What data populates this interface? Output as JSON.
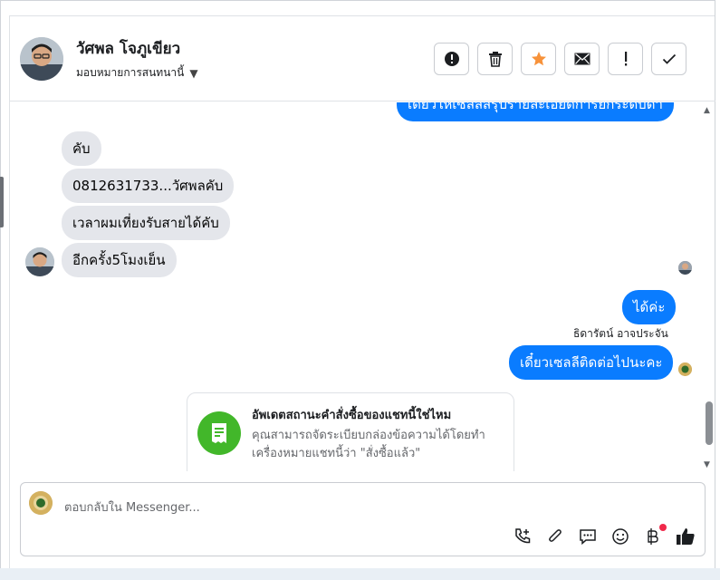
{
  "header": {
    "contact_name": "วัศพล โจภูเขียว",
    "assign_label": "มอบหมายการสนทนานี้",
    "actions": [
      {
        "name": "report-button",
        "icon": "alert-circle-icon"
      },
      {
        "name": "delete-button",
        "icon": "trash-icon"
      },
      {
        "name": "star-button",
        "icon": "star-icon"
      },
      {
        "name": "mark-unread-button",
        "icon": "envelope-icon"
      },
      {
        "name": "mark-important-button",
        "icon": "exclamation-icon"
      },
      {
        "name": "mark-done-button",
        "icon": "check-icon"
      }
    ],
    "star_color": "#f7923a"
  },
  "messages": {
    "top_partial": "เดี๋ยวให้เซลล์สรุปรายละเอียดการยกระดับดำ",
    "incoming": [
      "คับ",
      "0812631733...วัศพลคับ",
      "เวลาผมเที่ยงรับสายได้คับ",
      "อีกครั้ง5โมงเย็น"
    ],
    "outgoing_1": "ได้ค่ะ",
    "sender_name": "ธิดารัตน์ อาจประจัน",
    "outgoing_2": "เดี๋ยวเซลลีติดต่อไปนะคะ"
  },
  "order_card": {
    "title": "อัพเดตสถานะคำสั่งซื้อของแชทนี้ใช่ไหม",
    "text": "คุณสามารถจัดระเบียบกล่องข้อความได้โดยทำเครื่องหมายแชทนี้ว่า \"สั่งซื้อแล้ว\"",
    "icon": "receipt-icon",
    "color": "#42b72a"
  },
  "composer": {
    "placeholder": "ตอบกลับใน Messenger...",
    "tools": [
      "call-add-icon",
      "attachment-icon",
      "saved-reply-icon",
      "emoji-icon",
      "baht-payment-icon",
      "like-icon"
    ],
    "accent": "#0a7cff"
  }
}
